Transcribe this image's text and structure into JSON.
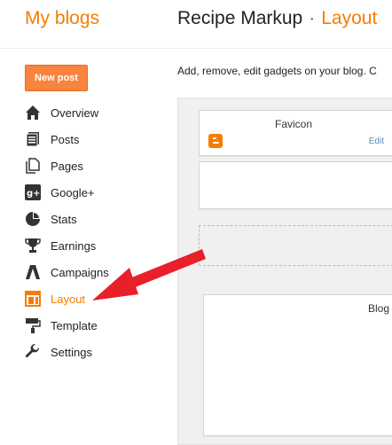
{
  "header": {
    "my_blogs": "My blogs",
    "blog_name": "Recipe Markup",
    "separator": "·",
    "current_page": "Layout"
  },
  "sidebar": {
    "new_post": "New post",
    "items": [
      {
        "label": "Overview",
        "icon": "home-icon"
      },
      {
        "label": "Posts",
        "icon": "posts-icon"
      },
      {
        "label": "Pages",
        "icon": "pages-icon"
      },
      {
        "label": "Google+",
        "icon": "google-plus-icon"
      },
      {
        "label": "Stats",
        "icon": "stats-icon"
      },
      {
        "label": "Earnings",
        "icon": "trophy-icon"
      },
      {
        "label": "Campaigns",
        "icon": "campaigns-icon"
      },
      {
        "label": "Layout",
        "icon": "layout-icon",
        "active": true
      },
      {
        "label": "Template",
        "icon": "template-icon"
      },
      {
        "label": "Settings",
        "icon": "wrench-icon"
      }
    ]
  },
  "main": {
    "intro": "Add, remove, edit gadgets on your blog. C",
    "gadgets": {
      "favicon_title": "Favicon",
      "favicon_edit": "Edit",
      "blog_title": "Blog"
    }
  },
  "colors": {
    "accent": "#f57d00",
    "button": "#f8843d",
    "arrow": "#e8202a",
    "link": "#5a8ab8"
  }
}
